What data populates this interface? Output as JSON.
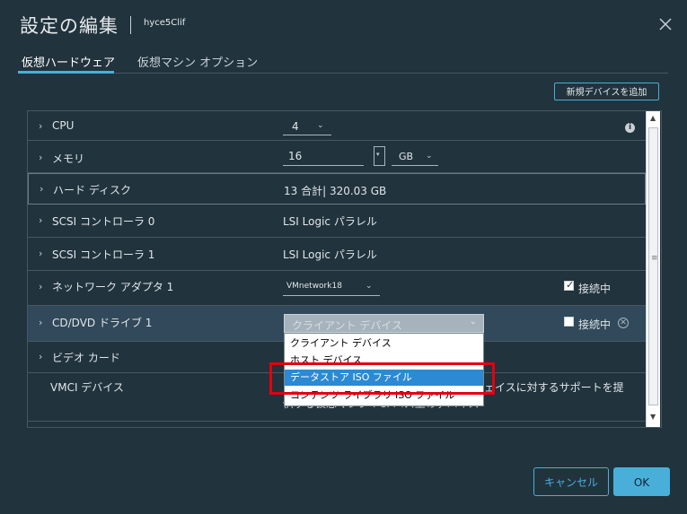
{
  "dialog": {
    "title": "設定の編集",
    "vm_name": "hyce5Clif",
    "close_icon": "close-icon"
  },
  "tabs": [
    {
      "label": "仮想ハードウェア",
      "active": true
    },
    {
      "label": "仮想マシン オプション",
      "active": false
    }
  ],
  "toolbar": {
    "add_device_label": "新規デバイスを追加"
  },
  "hardware": {
    "cpu": {
      "label": "CPU",
      "value": "4"
    },
    "memory": {
      "label": "メモリ",
      "value": "16",
      "unit": "GB"
    },
    "hard_disk": {
      "label": "ハード ディスク",
      "value": "13 合計| 320.03 GB"
    },
    "scsi0": {
      "label": "SCSI コントローラ 0",
      "value": "LSI Logic パラレル"
    },
    "scsi1": {
      "label": "SCSI コントローラ 1",
      "value": "LSI Logic パラレル"
    },
    "network": {
      "label": "ネットワーク アダプタ 1",
      "value": "VMnetwork18",
      "connected_label": "接続中",
      "connected": true
    },
    "cddvd": {
      "label": "CD/DVD ドライブ 1",
      "value": "クライアント デバイス",
      "connected_label": "接続中",
      "connected": false
    },
    "video": {
      "label": "ビデオ カード"
    },
    "vmci": {
      "label": "VMCI デバイス",
      "desc_line1": "ェイスに対するサポートを提",
      "desc_line2": "供する仮想マシン PCI バス上のデバイス"
    }
  },
  "dropdown": {
    "options": [
      "クライアント デバイス",
      "ホスト デバイス",
      "データストア ISO ファイル",
      "コンテンツ ライブラリ ISO ファイル"
    ],
    "selected_index": 2
  },
  "footer": {
    "cancel_label": "キャンセル",
    "ok_label": "OK"
  },
  "colors": {
    "accent": "#49afd9",
    "highlight_border": "#e3000b",
    "selected_option": "#2b8ad3"
  }
}
